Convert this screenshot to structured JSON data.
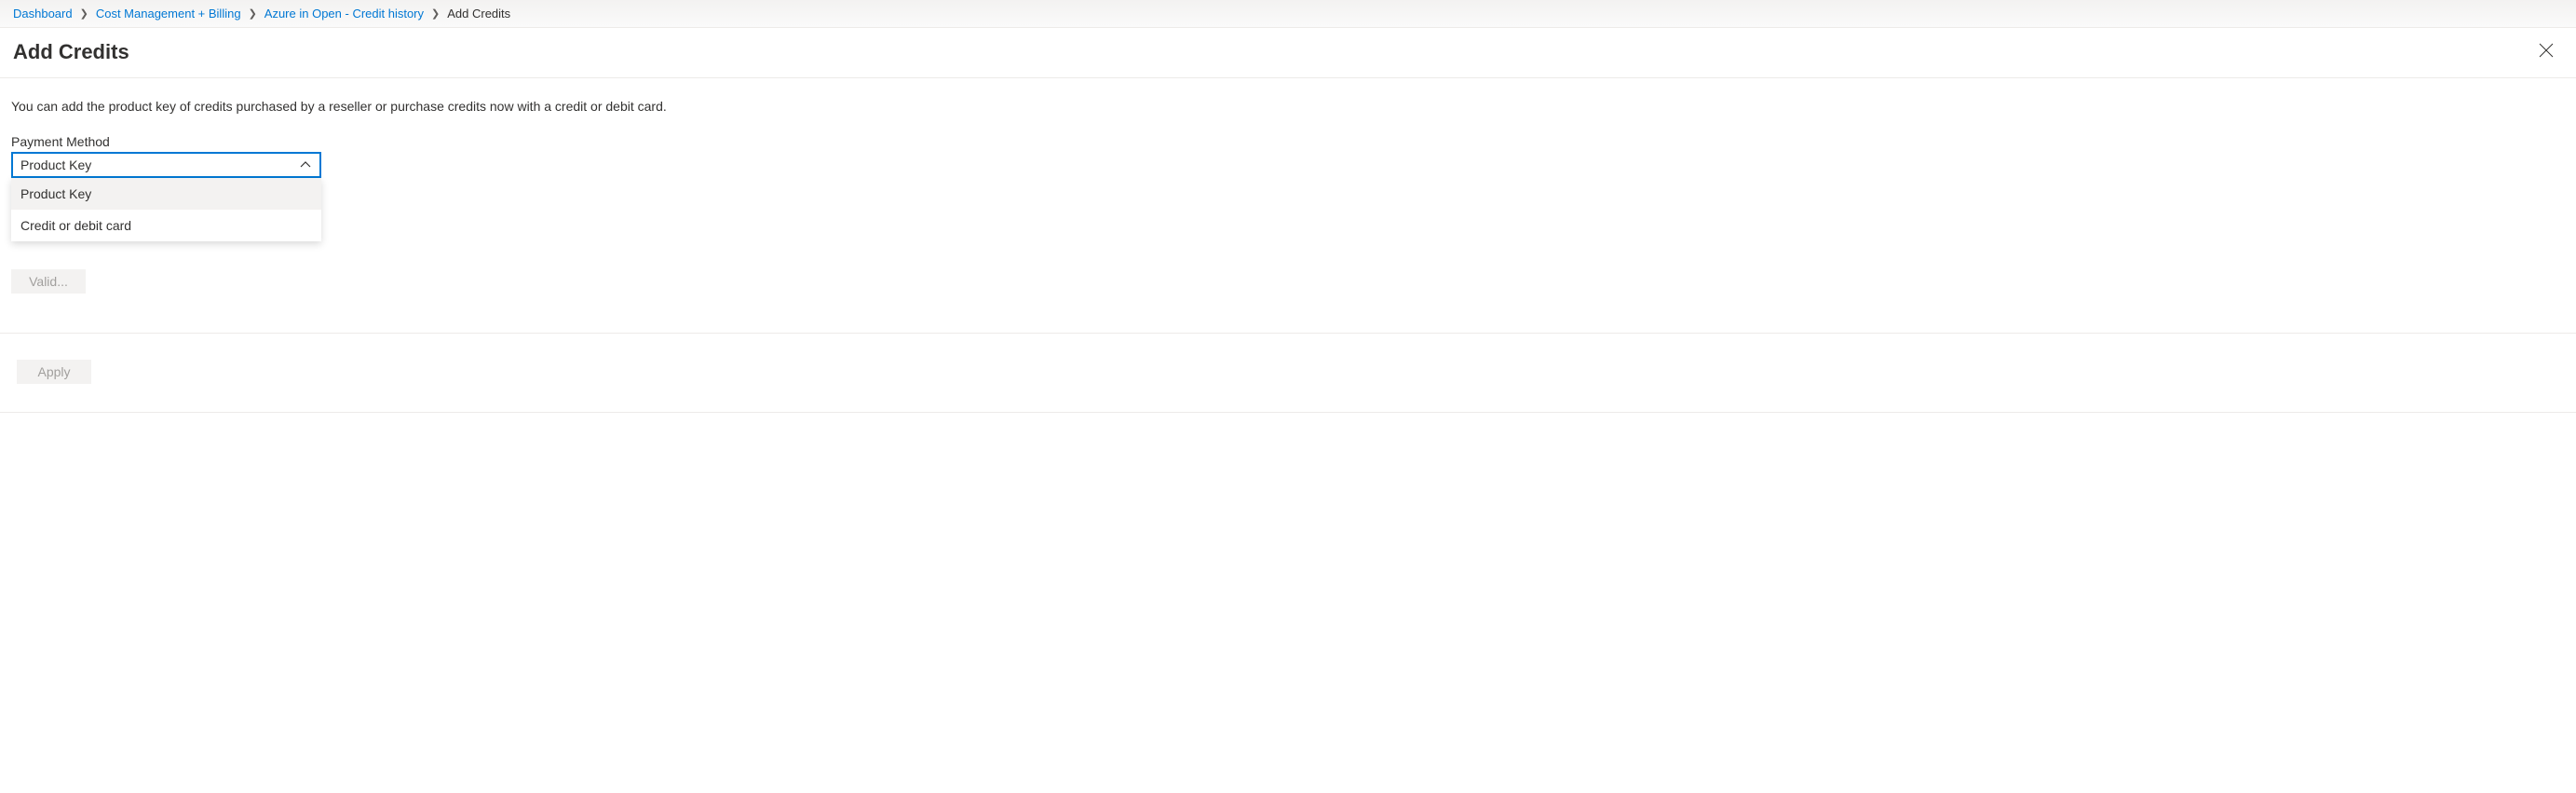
{
  "breadcrumb": {
    "items": [
      {
        "label": "Dashboard",
        "link": true
      },
      {
        "label": "Cost Management + Billing",
        "link": true
      },
      {
        "label": "Azure in Open - Credit history",
        "link": true
      },
      {
        "label": "Add Credits",
        "link": false
      }
    ]
  },
  "title": "Add Credits",
  "description": "You can add the product key of credits purchased by a reseller or purchase credits now with a credit or debit card.",
  "paymentMethod": {
    "label": "Payment Method",
    "selected": "Product Key",
    "options": [
      {
        "label": "Product Key"
      },
      {
        "label": "Credit or debit card"
      }
    ]
  },
  "buttons": {
    "validate": "Valid...",
    "apply": "Apply"
  }
}
